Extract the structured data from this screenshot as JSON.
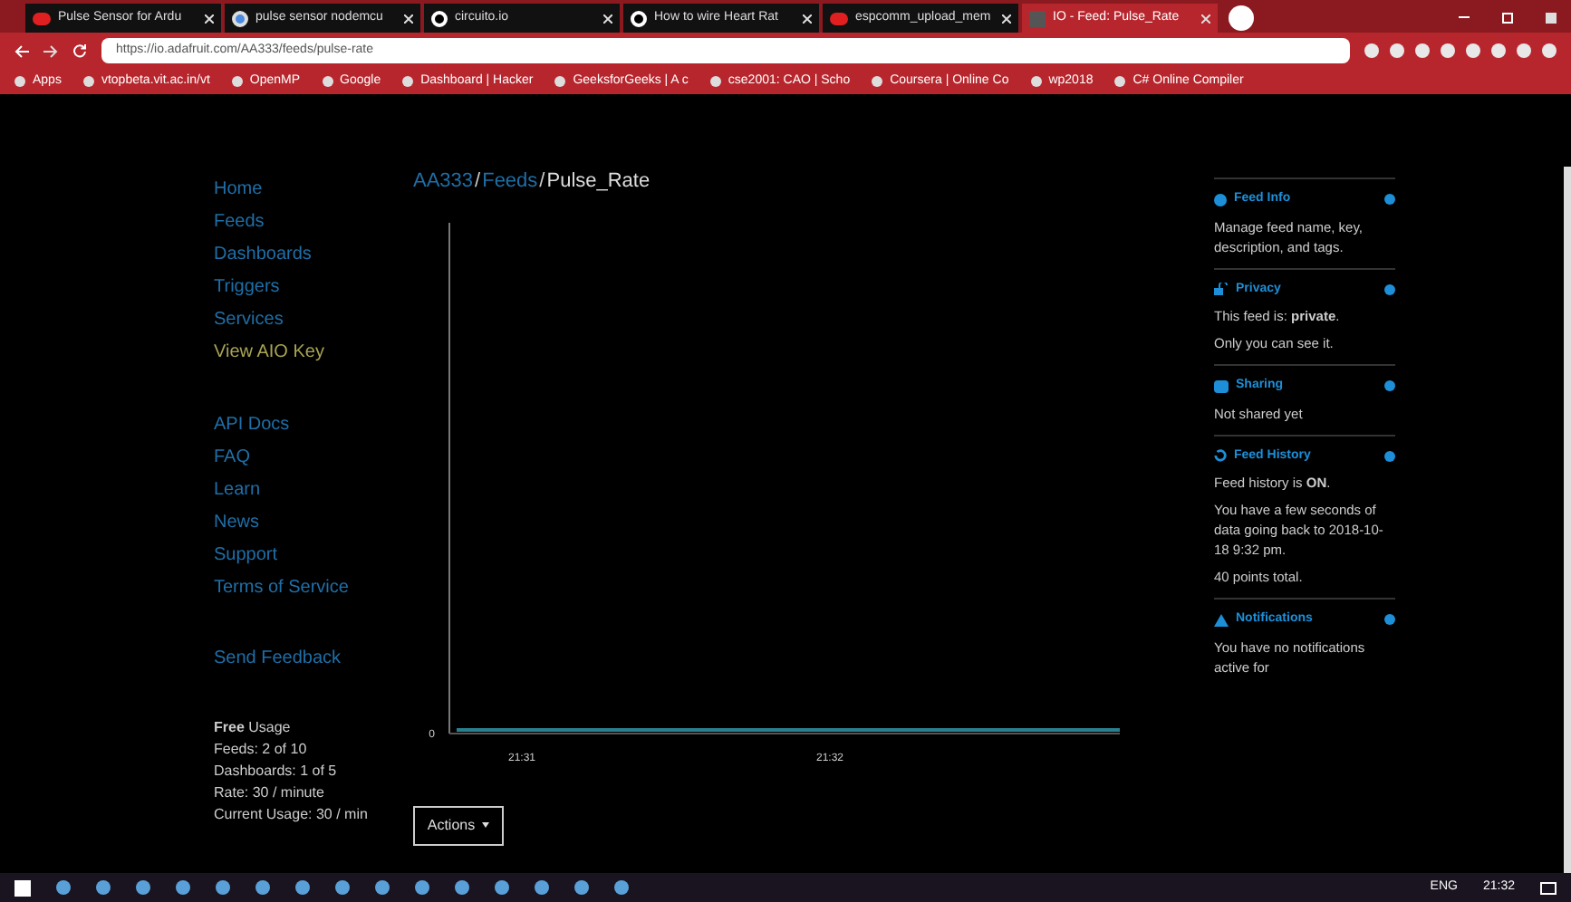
{
  "browser": {
    "tabs": [
      {
        "title": "Pulse Sensor for Ardu",
        "kind": "video",
        "selected": false
      },
      {
        "title": "pulse sensor nodemcu",
        "kind": "search",
        "selected": false
      },
      {
        "title": "circuito.io",
        "kind": "circle",
        "selected": false
      },
      {
        "title": "How to wire Heart Rat",
        "kind": "circle",
        "selected": false
      },
      {
        "title": "espcomm_upload_mem",
        "kind": "video",
        "selected": false
      },
      {
        "title": "IO - Feed: Pulse_Rate",
        "kind": "io",
        "selected": true
      }
    ],
    "url": "https://io.adafruit.com/AA333/feeds/pulse-rate",
    "bookmarks": [
      "Apps",
      "vtopbeta.vit.ac.in/vt",
      "OpenMP",
      "Google",
      "Dashboard | Hacker",
      "GeeksforGeeks | A c",
      "cse2001: CAO | Scho",
      "Coursera | Online Co",
      "wp2018",
      "C# Online Compiler"
    ]
  },
  "sidebar": {
    "items": [
      {
        "label": "Home",
        "color": "#1f6fa8"
      },
      {
        "label": "Feeds",
        "color": "#1f6fa8"
      },
      {
        "label": "Dashboards",
        "color": "#1f6fa8"
      },
      {
        "label": "Triggers",
        "color": "#1f6fa8"
      },
      {
        "label": "Services",
        "color": "#1f6fa8"
      },
      {
        "label": "View AIO Key",
        "color": "#a8a454"
      }
    ],
    "links": [
      "API Docs",
      "FAQ",
      "Learn",
      "News",
      "Support",
      "Terms of Service"
    ],
    "feedback": "Send Feedback",
    "usage": [
      "**Free** Usage",
      "Feeds: 2 of 10",
      "Dashboards: 1 of 5",
      "Rate: 30 / minute",
      "Current Usage: 30 / min"
    ]
  },
  "breadcrumb": [
    {
      "kind": "link",
      "label": "AA333"
    },
    {
      "kind": "separator",
      "label": "/"
    },
    {
      "kind": "link",
      "label": "Feeds"
    },
    {
      "kind": "separator",
      "label": "/"
    },
    {
      "kind": "current",
      "label": "Pulse_Rate"
    }
  ],
  "chart": {
    "y_label": "0",
    "x_labels": [
      "21:31",
      "21:32"
    ]
  },
  "actions_button": "Actions",
  "panels": [
    {
      "kind": "info",
      "title": "Feed Info",
      "paragraphs": [
        "Manage feed name, key, description, and tags."
      ]
    },
    {
      "kind": "lock",
      "title": "Privacy",
      "paragraphs": [
        "This feed is: **private**.",
        "Only you can see it."
      ]
    },
    {
      "kind": "share",
      "title": "Sharing",
      "paragraphs": [
        "Not shared yet"
      ]
    },
    {
      "kind": "history",
      "title": "Feed History",
      "paragraphs": [
        "Feed history is **ON**.",
        "You have a few seconds of data going back to 2018-10-18 9:32 pm.",
        "40 points total."
      ]
    },
    {
      "kind": "warning",
      "title": "Notifications",
      "paragraphs": [
        "You have no notifications active for"
      ]
    }
  ],
  "taskbar": {
    "language": "ENG",
    "time": "21:32"
  }
}
